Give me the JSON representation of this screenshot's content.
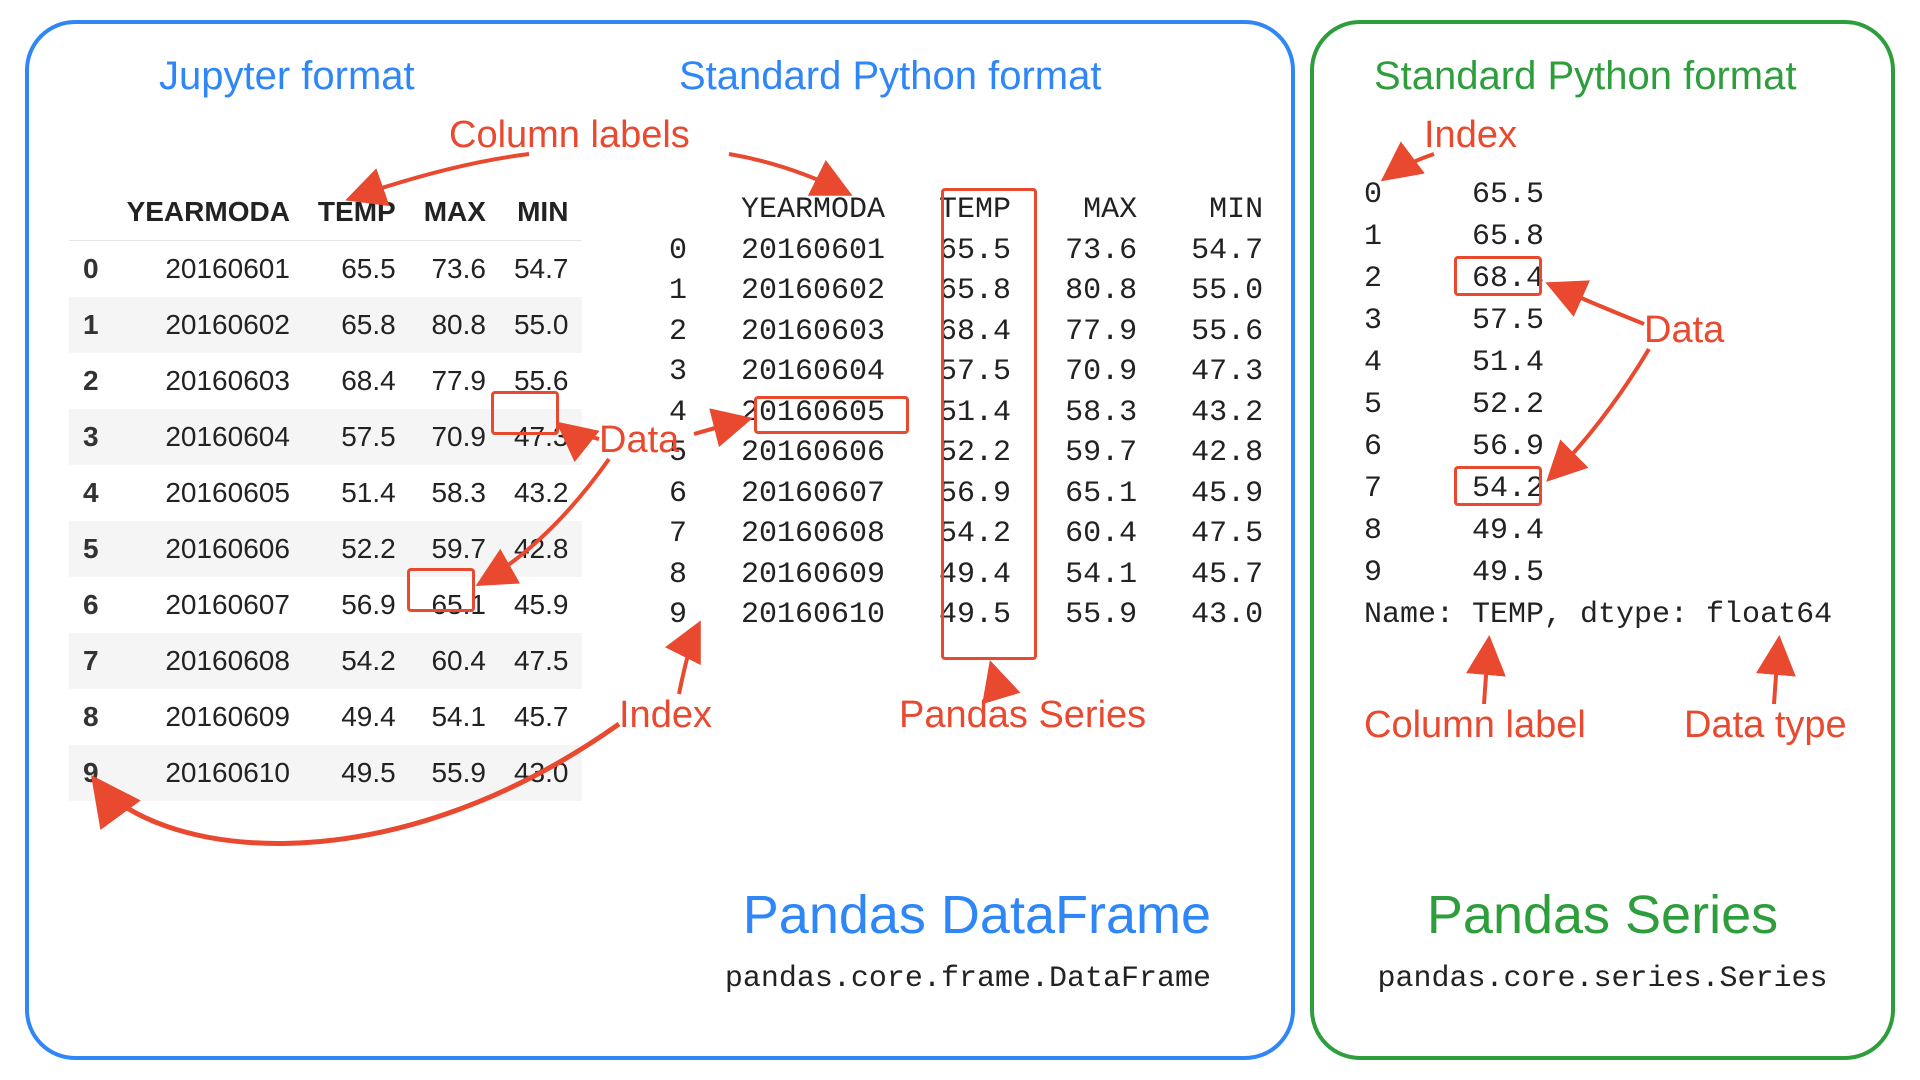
{
  "df_panel": {
    "title_left": "Jupyter format",
    "title_right": "Standard Python format",
    "main_title": "Pandas DataFrame",
    "subtitle": "pandas.core.frame.DataFrame"
  },
  "series_panel": {
    "title": "Standard Python format",
    "main_title": "Pandas Series",
    "subtitle": "pandas.core.series.Series",
    "footer": "Name: TEMP, dtype: float64"
  },
  "annotations": {
    "column_labels": "Column labels",
    "data": "Data",
    "index": "Index",
    "pandas_series": "Pandas Series",
    "column_label": "Column label",
    "data_type": "Data type"
  },
  "columns": [
    "YEARMODA",
    "TEMP",
    "MAX",
    "MIN"
  ],
  "rows": [
    {
      "idx": "0",
      "YEARMODA": "20160601",
      "TEMP": "65.5",
      "MAX": "73.6",
      "MIN": "54.7"
    },
    {
      "idx": "1",
      "YEARMODA": "20160602",
      "TEMP": "65.8",
      "MAX": "80.8",
      "MIN": "55.0"
    },
    {
      "idx": "2",
      "YEARMODA": "20160603",
      "TEMP": "68.4",
      "MAX": "77.9",
      "MIN": "55.6"
    },
    {
      "idx": "3",
      "YEARMODA": "20160604",
      "TEMP": "57.5",
      "MAX": "70.9",
      "MIN": "47.3"
    },
    {
      "idx": "4",
      "YEARMODA": "20160605",
      "TEMP": "51.4",
      "MAX": "58.3",
      "MIN": "43.2"
    },
    {
      "idx": "5",
      "YEARMODA": "20160606",
      "TEMP": "52.2",
      "MAX": "59.7",
      "MIN": "42.8"
    },
    {
      "idx": "6",
      "YEARMODA": "20160607",
      "TEMP": "56.9",
      "MAX": "65.1",
      "MIN": "45.9"
    },
    {
      "idx": "7",
      "YEARMODA": "20160608",
      "TEMP": "54.2",
      "MAX": "60.4",
      "MIN": "47.5"
    },
    {
      "idx": "8",
      "YEARMODA": "20160609",
      "TEMP": "49.4",
      "MAX": "54.1",
      "MIN": "45.7"
    },
    {
      "idx": "9",
      "YEARMODA": "20160610",
      "TEMP": "49.5",
      "MAX": "55.9",
      "MIN": "43.0"
    }
  ],
  "series_name": "TEMP",
  "series_dtype": "float64"
}
